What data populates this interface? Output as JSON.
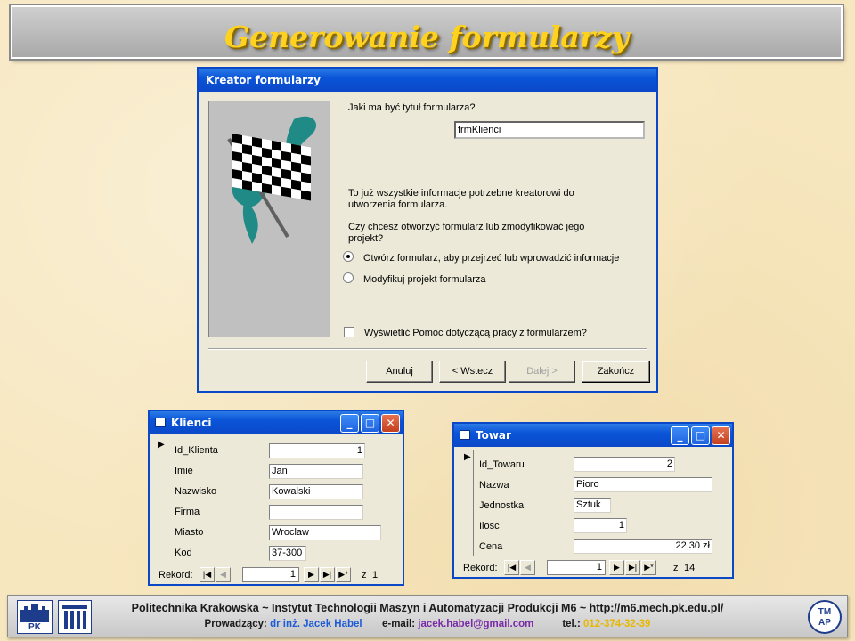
{
  "slide": {
    "title": "Generowanie formularzy"
  },
  "wizard": {
    "title": "Kreator formularzy",
    "question": "Jaki ma być tytuł formularza?",
    "title_value": "frmKlienci",
    "info_line1": "To już wszystkie informacje potrzebne kreatorowi do",
    "info_line2": "utworzenia formularza.",
    "question2_line1": "Czy chcesz otworzyć formularz lub zmodyfikować jego",
    "question2_line2": "projekt?",
    "option_open": "Otwórz formularz, aby przejrzeć lub wprowadzić informacje",
    "option_modify": "Modyfikuj projekt formularza",
    "help_checkbox": "Wyświetlić Pomoc dotyczącą pracy z formularzem?",
    "buttons": {
      "cancel": "Anuluj",
      "back": "< Wstecz",
      "next": "Dalej >",
      "finish": "Zakończ"
    }
  },
  "klienci": {
    "title": "Klienci",
    "fields": [
      {
        "label": "Id_Klienta",
        "value": "1"
      },
      {
        "label": "Imie",
        "value": "Jan"
      },
      {
        "label": "Nazwisko",
        "value": "Kowalski"
      },
      {
        "label": "Firma",
        "value": ""
      },
      {
        "label": "Miasto",
        "value": "Wroclaw"
      },
      {
        "label": "Kod",
        "value": "37-300"
      }
    ],
    "nav": {
      "label": "Rekord:",
      "current": "1",
      "of": "z",
      "total": "1"
    }
  },
  "towar": {
    "title": "Towar",
    "fields": [
      {
        "label": "Id_Towaru",
        "value": "2"
      },
      {
        "label": "Nazwa",
        "value": "Pioro"
      },
      {
        "label": "Jednostka",
        "value": "Sztuk"
      },
      {
        "label": "Ilosc",
        "value": "1"
      },
      {
        "label": "Cena",
        "value": "22,30 zł"
      }
    ],
    "nav": {
      "label": "Rekord:",
      "current": "1",
      "of": "z",
      "total": "14"
    }
  },
  "footer": {
    "line1": "Politechnika Krakowska   ~   Instytut Technologii Maszyn i Automatyzacji Produkcji M6   ~   http://m6.mech.pk.edu.pl/",
    "teacher_label": "Prowadzący:",
    "teacher_name": "dr inż. Jacek Habel",
    "email_label": "e-mail:",
    "email": "jacek.habel@gmail.com",
    "phone_label": "tel.:",
    "phone": "012-374-32-39",
    "logo_left": "PK",
    "logo_right_line1": "TM",
    "logo_right_line2": "AP"
  },
  "colors": {
    "background": "#f7e7bf",
    "title": "#ffd21f",
    "xp_titlebar": "#0a54d8",
    "footer_name": "#1e5bd6",
    "footer_email": "#7a2aa8",
    "footer_phone": "#e8b800"
  }
}
